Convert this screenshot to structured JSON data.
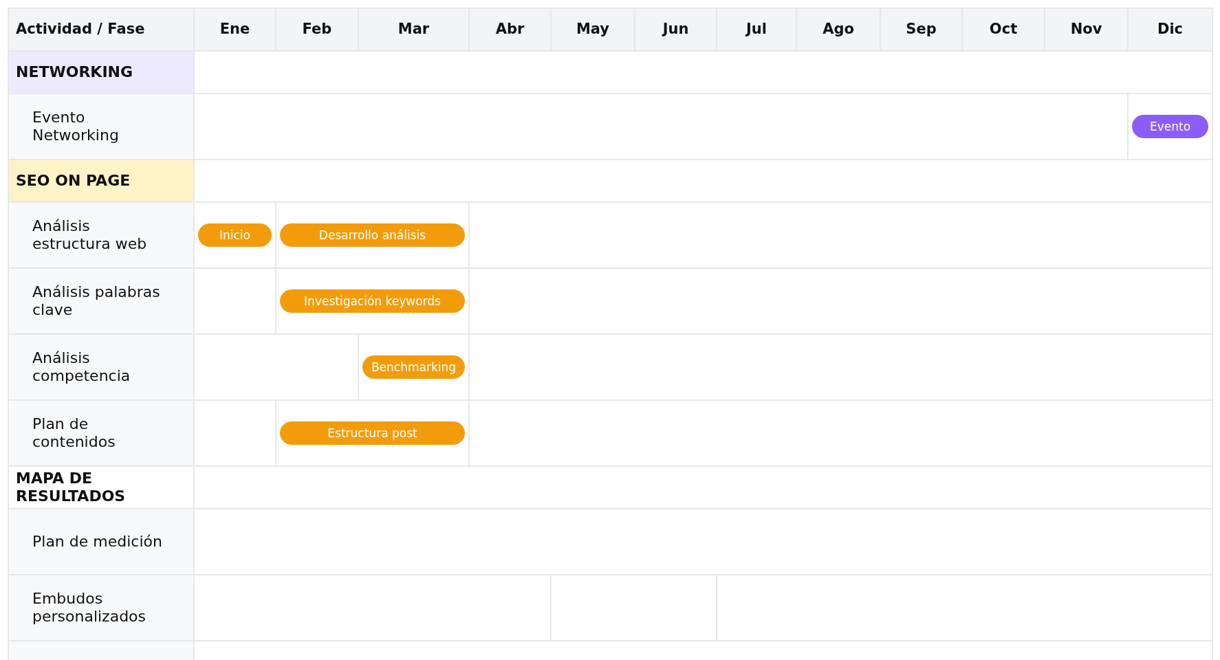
{
  "table": {
    "corner": "Actividad / Fase",
    "months": [
      "Ene",
      "Feb",
      "Mar",
      "Abr",
      "May",
      "Jun",
      "Jul",
      "Ago",
      "Sep",
      "Oct",
      "Nov",
      "Dic"
    ],
    "rows": [
      {
        "kind": "group",
        "label": "NETWORKING",
        "color": "#ede9fe",
        "cells": [
          {
            "colspan": 12
          }
        ]
      },
      {
        "kind": "task",
        "label": "Evento Networking",
        "cells": [
          {
            "colspan": 11
          },
          {
            "bar": {
              "label": "Evento",
              "color": "#8b5cf6"
            }
          }
        ]
      },
      {
        "kind": "group",
        "label": "SEO ON PAGE",
        "color": "#fef3c7",
        "cells": [
          {
            "colspan": 12
          }
        ]
      },
      {
        "kind": "task",
        "label": "Análisis estructura web",
        "cells": [
          {
            "bar": {
              "label": "Inicio",
              "color": "#f39c0b"
            }
          },
          {
            "colspan": 2,
            "bar": {
              "label": "Desarrollo análisis",
              "color": "#f39c0b"
            }
          },
          {
            "colspan": 9
          }
        ]
      },
      {
        "kind": "task",
        "label": "Análisis palabras clave",
        "cells": [
          {},
          {
            "colspan": 2,
            "bar": {
              "label": "Investigación keywords",
              "color": "#f39c0b"
            }
          },
          {
            "colspan": 9
          }
        ]
      },
      {
        "kind": "task",
        "label": "Análisis competencia",
        "cells": [
          {
            "colspan": 2
          },
          {
            "bar": {
              "label": "Benchmarking",
              "color": "#f39c0b"
            }
          },
          {
            "colspan": 9
          }
        ]
      },
      {
        "kind": "task",
        "label": "Plan de contenidos",
        "cells": [
          {},
          {
            "colspan": 2,
            "bar": {
              "label": "Estructura post",
              "color": "#f39c0b"
            }
          },
          {
            "colspan": 9
          }
        ]
      },
      {
        "kind": "group",
        "label": "MAPA DE RESULTADOS",
        "color": "#ffffff",
        "cells": [
          {
            "colspan": 12
          }
        ]
      },
      {
        "kind": "task",
        "label": "Plan de medición",
        "cells": [
          {
            "colspan": 12
          }
        ]
      },
      {
        "kind": "task",
        "label": "Embudos personalizados",
        "cells": [
          {
            "colspan": 4
          },
          {
            "colspan": 2
          },
          {
            "colspan": 6
          }
        ]
      },
      {
        "kind": "task",
        "cells": [
          {
            "colspan": 12
          }
        ]
      }
    ]
  }
}
